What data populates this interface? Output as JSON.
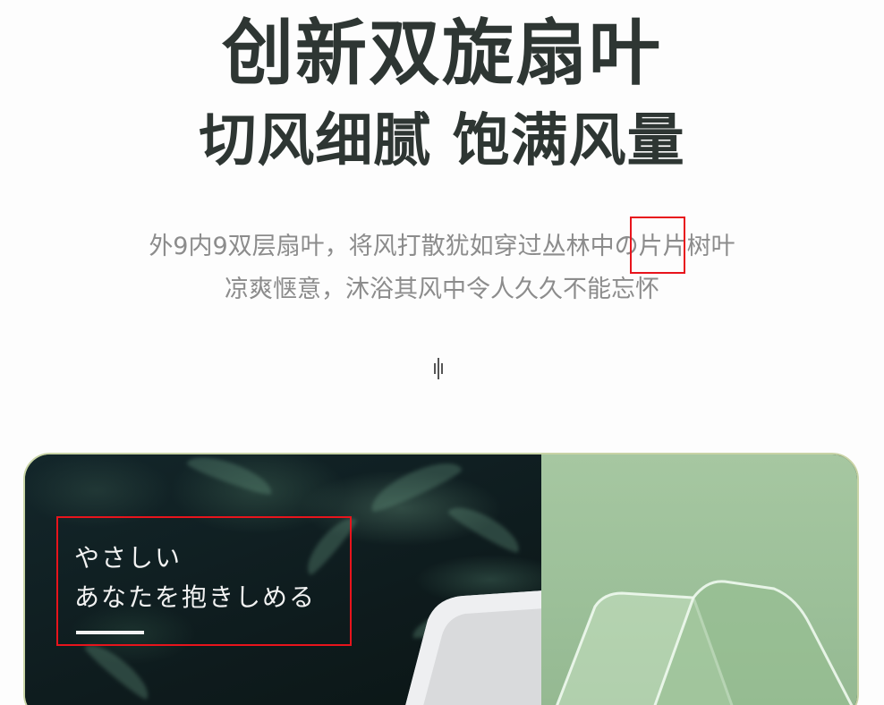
{
  "headline": {
    "line1": "创新双旋扇叶",
    "line2": "切风细腻 饱满风量"
  },
  "description": {
    "line1": "外9内9双层扇叶，将风打散犹如穿过丛林中の片片树叶",
    "line2": "凉爽惬意，沐浴其风中令人久久不能忘怀"
  },
  "card": {
    "jp_line1": "やさしい",
    "jp_line2": "あなたを抱きしめる"
  },
  "colors": {
    "headline": "#2e3633",
    "description": "#8c8c8c",
    "highlight_box": "#e8141c",
    "card_dark": "#0f1e1c",
    "card_green": "#a6c7a1",
    "card_border": "#c9d4a6"
  },
  "icons": {
    "scroll": "audio-wave-icon"
  }
}
